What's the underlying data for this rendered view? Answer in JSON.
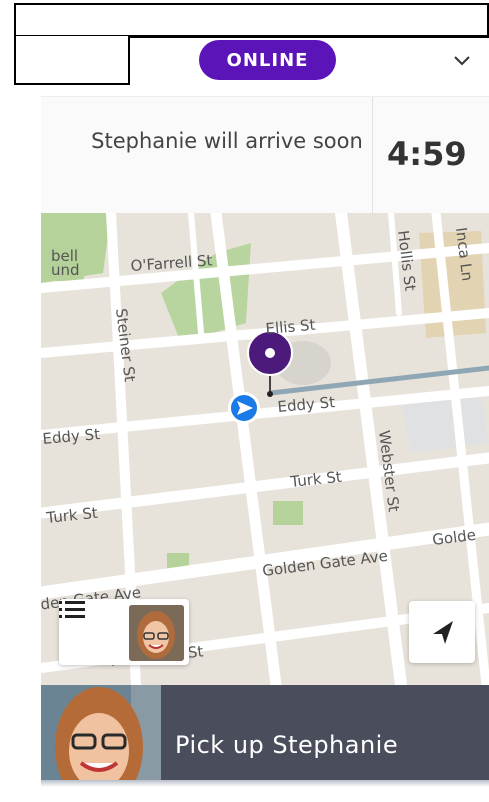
{
  "status": {
    "label": "ONLINE",
    "accent": "#5a14b8"
  },
  "arrival": {
    "message": "Stephanie will arrive soon",
    "eta": "4:59"
  },
  "map": {
    "streets": {
      "ofarrell": "O'Farrell St",
      "steiner": "Steiner St",
      "ellis": "Ellis St",
      "eddy_left": "Eddy St",
      "eddy_right": "Eddy St",
      "turk_left": "Turk St",
      "turk_right": "Turk St",
      "webster": "Webster St",
      "golden_gate_mid": "Golden Gate Ave",
      "golden_gate_right": "Golde",
      "golden_gate_left": "lden Gate Ave",
      "hollis": "Hollis St",
      "inca": "Inca Ln",
      "mcallister": "McAllister St",
      "park_partial": "bell\nund"
    },
    "route_color": "#8fa7b4",
    "pin_color": "#4b1a7a",
    "nav_color": "#1a7ae6"
  },
  "icons": {
    "chevron": "chevron-down-icon",
    "list": "list-icon",
    "locate": "navigation-arrow-icon"
  },
  "pickup": {
    "label": "Pick up Stephanie"
  }
}
